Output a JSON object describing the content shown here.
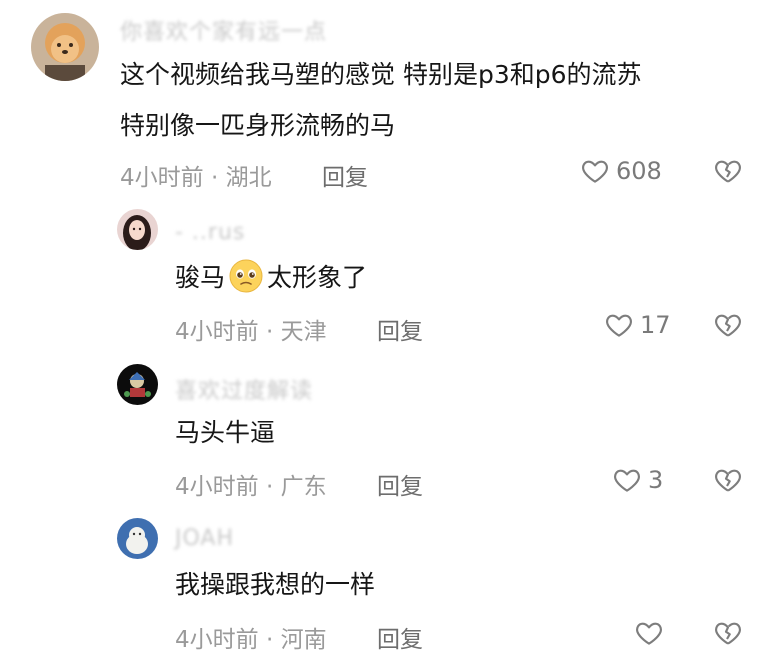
{
  "comments": [
    {
      "username": "你喜欢个家有远一点",
      "text_line1": "这个视频给我马塑的感觉 特别是p3和p6的流苏",
      "text_line2": "特别像一匹身形流畅的马",
      "meta": "4小时前 · 湖北",
      "reply_label": "回复",
      "likes": "608"
    },
    {
      "username": "- ..rus",
      "text_before_emoji": "骏马",
      "emoji": "pleading-face",
      "text_after_emoji": "太形象了",
      "meta": "4小时前 · 天津",
      "reply_label": "回复",
      "likes": "17"
    },
    {
      "username": "喜欢过度解读",
      "text": "马头牛逼",
      "meta": "4小时前 · 广东",
      "reply_label": "回复",
      "likes": "3"
    },
    {
      "username": "JOAH",
      "text": "我操跟我想的一样",
      "meta": "4小时前 · 河南",
      "reply_label": "回复"
    }
  ],
  "colors": {
    "icon_gray": "#7d7d7d",
    "meta_gray": "#9a9a9a",
    "text": "#161616"
  },
  "icons": {
    "like": "heart-outline-icon",
    "dislike": "broken-heart-outline-icon"
  }
}
